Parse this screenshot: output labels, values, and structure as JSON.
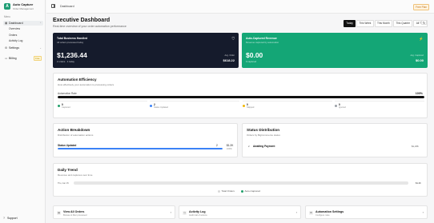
{
  "app": {
    "logo_letter": "A",
    "name": "Auto Capture",
    "subtitle": "Order Management"
  },
  "sidebar": {
    "menu_label": "Menu",
    "dashboard": "Dashboard",
    "dashboard_sub": [
      "Overview",
      "Orders",
      "Activity Log"
    ],
    "settings": "Settings",
    "billing": "Billing",
    "billing_badge": "Free",
    "support": "Support"
  },
  "topbar": {
    "breadcrumb": "Dashboard",
    "plan_badge": "Free Plan"
  },
  "header": {
    "title": "Executive Dashboard",
    "subtitle": "Real-time overview of your order automation performance"
  },
  "ranges": [
    "Today",
    "This Week",
    "This Month",
    "This Quarter",
    "All Time"
  ],
  "active_range": "Today",
  "kpi": {
    "business": {
      "title": "Total Business Handled",
      "sub": "All orders processed today",
      "value": "$1,236.44",
      "foot": "2 orders · 1 today",
      "avg_label": "Avg. Order",
      "avg_value": "$618.22"
    },
    "auto": {
      "title": "Auto-Captured Revenue",
      "sub": "Revenue captured by automation",
      "value": "$0.00",
      "foot": "0 captured",
      "avg_label": "Avg. Captured",
      "avg_value": "$0.00"
    }
  },
  "efficiency": {
    "title": "Automation Efficiency",
    "subtitle": "How effectively your automation is processing orders",
    "rate_label": "Automation Rate",
    "rate_value": "100%",
    "rate_fraction": 1.0,
    "stats": [
      {
        "n": "0",
        "label": "Captured",
        "color": "#22a06b"
      },
      {
        "n": "2",
        "label": "Status Updated",
        "color": "#3b82f6"
      },
      {
        "n": "0",
        "label": "Skipped",
        "color": "#f2b705"
      },
      {
        "n": "0",
        "label": "Ignored",
        "color": "#9aa0a6"
      }
    ]
  },
  "breakdown": {
    "title": "Action Breakdown",
    "subtitle": "Distribution of automation actions",
    "row_label": "Status Updated",
    "row_count": "2",
    "row_value": "$1.2K",
    "row_pct": "100%",
    "fraction": 1.0
  },
  "status": {
    "title": "Status Distribution",
    "subtitle": "Orders by BigCommerce status",
    "row_count": "2",
    "row_label": "Awaiting Payment",
    "row_value": "$1,236"
  },
  "trend": {
    "title": "Daily Trend",
    "subtitle": "Revenue and captures over time",
    "day": "Thu, Jan 15",
    "value": "$1.2K",
    "fraction": 1.0,
    "legend": [
      {
        "label": "Total Orders",
        "color": "#d9d9d9"
      },
      {
        "label": "Auto-Captured",
        "color": "#22a06b"
      }
    ]
  },
  "quick": [
    {
      "icon": "▤",
      "title": "View All Orders",
      "sub": "Browse & filter processed",
      "arrow": "›"
    },
    {
      "icon": "◷",
      "title": "Activity Log",
      "sub": "Audit trail of actions",
      "arrow": "›"
    },
    {
      "icon": "⚙",
      "title": "Automation Settings",
      "sub": "Configure rules",
      "arrow": "›"
    }
  ]
}
